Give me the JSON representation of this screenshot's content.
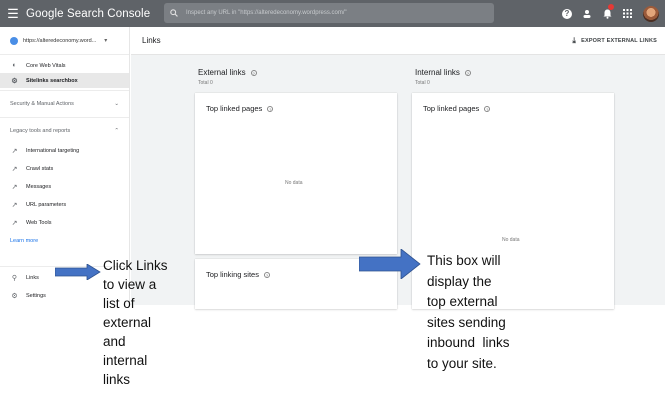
{
  "topbar": {
    "brand": "Google Search Console",
    "search_placeholder": "Inspect any URL in \"https://alteredeconomy.wordpress.com/\""
  },
  "sidebar": {
    "property_url": "https://alteredeconomy.word...",
    "items_top": [
      {
        "label": "Core Web Vitals",
        "icon": "speedometer-icon"
      },
      {
        "label": "Sitelinks searchbox",
        "icon": "sitelinks-icon"
      }
    ],
    "security_section": "Security & Manual Actions",
    "legacy_section": "Legacy tools and reports",
    "legacy_items": [
      {
        "label": "International targeting",
        "icon": "external-link-icon"
      },
      {
        "label": "Crawl stats",
        "icon": "external-link-icon"
      },
      {
        "label": "Messages",
        "icon": "external-link-icon"
      },
      {
        "label": "URL parameters",
        "icon": "external-link-icon"
      },
      {
        "label": "Web Tools",
        "icon": "external-link-icon"
      }
    ],
    "learn_more": "Learn more",
    "links_label": "Links",
    "settings_label": "Settings"
  },
  "main": {
    "title": "Links",
    "export_label": "EXPORT EXTERNAL LINKS",
    "external": {
      "heading": "External links",
      "total": "Total 0",
      "top_linked_pages": "Top linked pages",
      "no_data": "No data",
      "top_linking_sites": "Top linking sites"
    },
    "internal": {
      "heading": "Internal links",
      "total": "Total 0",
      "top_linked_pages": "Top linked pages",
      "no_data": "No data"
    }
  },
  "annotations": {
    "left_lines": [
      "Click Links",
      "to view a",
      "list of",
      "external",
      "and",
      "internal",
      "links"
    ],
    "right_lines": [
      "This box will",
      "display the",
      "top external",
      "sites sending",
      "inbound  links",
      "to your site."
    ],
    "arrow_color": "#4472c4"
  }
}
